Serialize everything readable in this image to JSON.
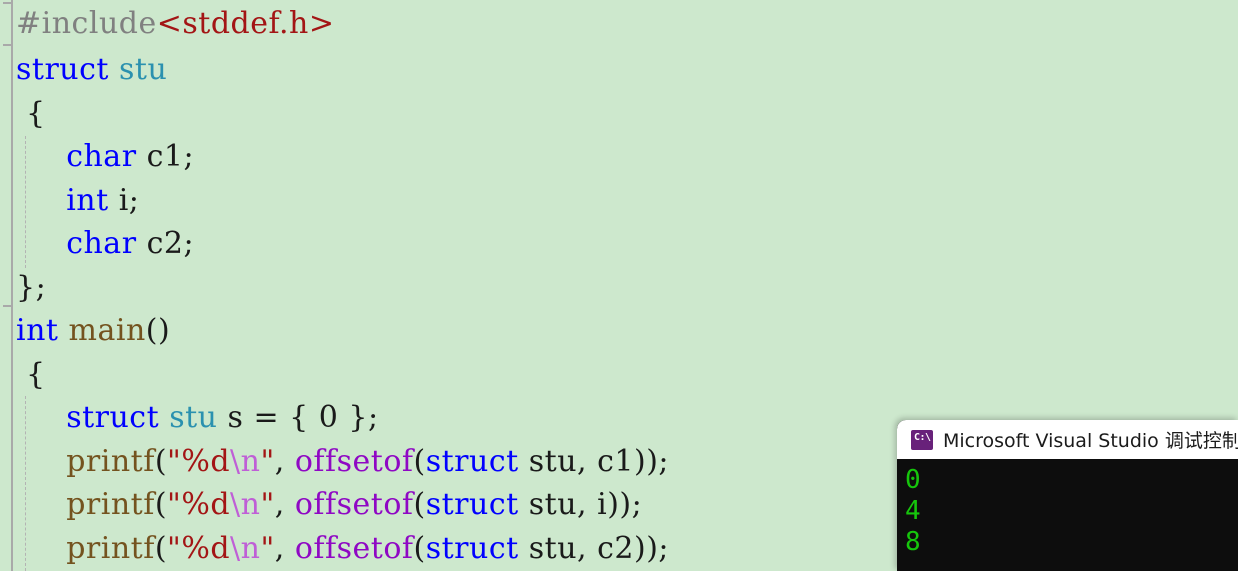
{
  "editor": {
    "background_color": "#cde8cd",
    "lines": [
      {
        "id": "line-include",
        "tokens": [
          {
            "text": "#include",
            "cls": "t-pre"
          },
          {
            "text": "<stddef.h>",
            "cls": "t-inc"
          }
        ]
      },
      {
        "id": "line-struct-decl",
        "fold": true,
        "tokens": [
          {
            "text": "struct",
            "cls": "t-kw"
          },
          {
            "text": " ",
            "cls": "t-plain"
          },
          {
            "text": "stu",
            "cls": "t-type"
          }
        ]
      },
      {
        "id": "line-struct-open",
        "tokens": [
          {
            "text": " {",
            "cls": "t-plain"
          }
        ]
      },
      {
        "id": "line-member-c1",
        "tokens": [
          {
            "text": "     ",
            "cls": "t-plain"
          },
          {
            "text": "char",
            "cls": "t-kw"
          },
          {
            "text": " c1;",
            "cls": "t-plain"
          }
        ]
      },
      {
        "id": "line-member-i",
        "tokens": [
          {
            "text": "     ",
            "cls": "t-plain"
          },
          {
            "text": "int",
            "cls": "t-kw"
          },
          {
            "text": " i;",
            "cls": "t-plain"
          }
        ]
      },
      {
        "id": "line-member-c2",
        "tokens": [
          {
            "text": "     ",
            "cls": "t-plain"
          },
          {
            "text": "char",
            "cls": "t-kw"
          },
          {
            "text": " c2;",
            "cls": "t-plain"
          }
        ]
      },
      {
        "id": "line-struct-close",
        "tokens": [
          {
            "text": "};",
            "cls": "t-plain"
          }
        ]
      },
      {
        "id": "line-main-decl",
        "fold": true,
        "tokens": [
          {
            "text": "int",
            "cls": "t-kw"
          },
          {
            "text": " ",
            "cls": "t-plain"
          },
          {
            "text": "main",
            "cls": "t-fn"
          },
          {
            "text": "()",
            "cls": "t-plain"
          }
        ]
      },
      {
        "id": "line-main-open",
        "tokens": [
          {
            "text": " {",
            "cls": "t-plain"
          }
        ]
      },
      {
        "id": "line-decl-s",
        "tokens": [
          {
            "text": "     ",
            "cls": "t-plain"
          },
          {
            "text": "struct",
            "cls": "t-kw"
          },
          {
            "text": " ",
            "cls": "t-plain"
          },
          {
            "text": "stu",
            "cls": "t-type"
          },
          {
            "text": " s = { 0 };",
            "cls": "t-plain"
          }
        ]
      },
      {
        "id": "line-printf-c1",
        "tokens": [
          {
            "text": "     ",
            "cls": "t-plain"
          },
          {
            "text": "printf",
            "cls": "t-fn"
          },
          {
            "text": "(",
            "cls": "t-plain"
          },
          {
            "text": "\"%d",
            "cls": "t-str"
          },
          {
            "text": "\\n",
            "cls": "t-esc"
          },
          {
            "text": "\"",
            "cls": "t-str"
          },
          {
            "text": ", ",
            "cls": "t-plain"
          },
          {
            "text": "offsetof",
            "cls": "t-macro"
          },
          {
            "text": "(",
            "cls": "t-plain"
          },
          {
            "text": "struct",
            "cls": "t-kw"
          },
          {
            "text": " stu, c1));",
            "cls": "t-plain"
          }
        ]
      },
      {
        "id": "line-printf-i",
        "tokens": [
          {
            "text": "     ",
            "cls": "t-plain"
          },
          {
            "text": "printf",
            "cls": "t-fn"
          },
          {
            "text": "(",
            "cls": "t-plain"
          },
          {
            "text": "\"%d",
            "cls": "t-str"
          },
          {
            "text": "\\n",
            "cls": "t-esc"
          },
          {
            "text": "\"",
            "cls": "t-str"
          },
          {
            "text": ", ",
            "cls": "t-plain"
          },
          {
            "text": "offsetof",
            "cls": "t-macro"
          },
          {
            "text": "(",
            "cls": "t-plain"
          },
          {
            "text": "struct",
            "cls": "t-kw"
          },
          {
            "text": " stu, i));",
            "cls": "t-plain"
          }
        ]
      },
      {
        "id": "line-printf-c2",
        "tokens": [
          {
            "text": "     ",
            "cls": "t-plain"
          },
          {
            "text": "printf",
            "cls": "t-fn"
          },
          {
            "text": "(",
            "cls": "t-plain"
          },
          {
            "text": "\"%d",
            "cls": "t-str"
          },
          {
            "text": "\\n",
            "cls": "t-esc"
          },
          {
            "text": "\"",
            "cls": "t-str"
          },
          {
            "text": ", ",
            "cls": "t-plain"
          },
          {
            "text": "offsetof",
            "cls": "t-macro"
          },
          {
            "text": "(",
            "cls": "t-plain"
          },
          {
            "text": "struct",
            "cls": "t-kw"
          },
          {
            "text": " stu, c2));",
            "cls": "t-plain"
          }
        ]
      }
    ]
  },
  "console": {
    "icon_name": "command-prompt-icon",
    "icon_glyph": "C:\\",
    "icon_color": "#68217a",
    "title": "Microsoft Visual Studio 调试控制台",
    "text_color": "#16c60c",
    "background_color": "#0d0d0d",
    "output": [
      "0",
      "4",
      "8"
    ]
  }
}
